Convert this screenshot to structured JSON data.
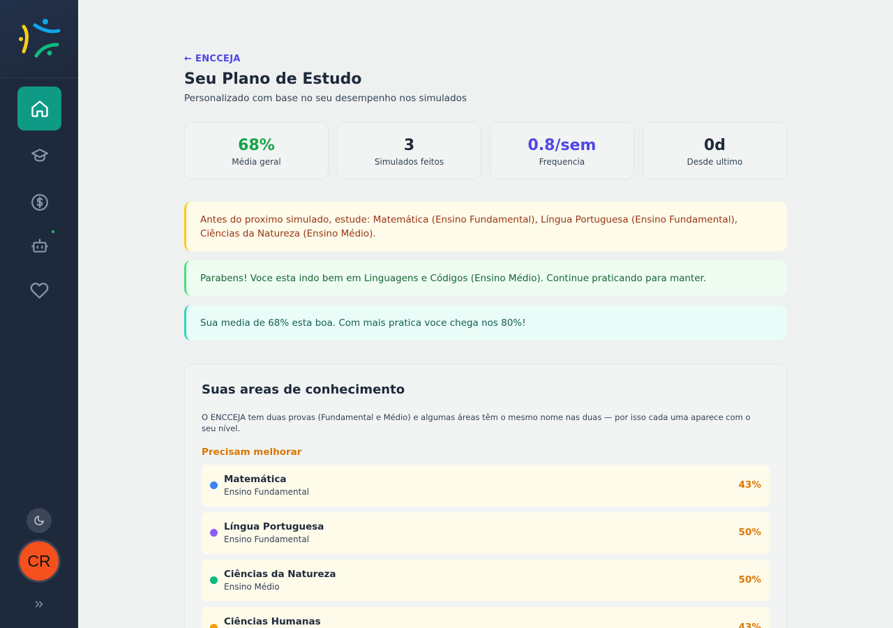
{
  "sidebar": {
    "nav": [
      {
        "name": "home",
        "icon": "home-icon",
        "active": true
      },
      {
        "name": "courses",
        "icon": "graduation-cap-icon",
        "active": false
      },
      {
        "name": "finance",
        "icon": "dollar-circle-icon",
        "active": false
      },
      {
        "name": "assistant",
        "icon": "bot-icon",
        "active": false
      },
      {
        "name": "favorites",
        "icon": "heart-icon",
        "active": false
      }
    ],
    "avatar_initials": "CR",
    "colors": {
      "background": "#1e293b",
      "active": "#0f9a86",
      "avatar": "#f4511e"
    }
  },
  "header": {
    "back_label": "← ENCCEJA",
    "title": "Seu Plano de Estudo",
    "subtitle": "Personalizado com base no seu desempenho nos simulados"
  },
  "stats": [
    {
      "value": "68%",
      "label": "Média geral",
      "color": "#16a34a"
    },
    {
      "value": "3",
      "label": "Simulados feitos",
      "color": "#1e293b"
    },
    {
      "value": "0.8/sem",
      "label": "Frequencia",
      "color": "#4f46e5"
    },
    {
      "value": "0d",
      "label": "Desde ultimo",
      "color": "#1e293b"
    }
  ],
  "alerts": {
    "warning": "Antes do proximo simulado, estude: Matemática (Ensino Fundamental), Língua Portuguesa (Ensino Fundamental), Ciências da Natureza (Ensino Médio).",
    "success": "Parabens! Voce esta indo bem em Linguagens e Códigos (Ensino Médio). Continue praticando para manter.",
    "info": "Sua media de 68% esta boa. Com mais pratica voce chega nos 80%!"
  },
  "areas": {
    "title": "Suas areas de conhecimento",
    "description": "O ENCCEJA tem duas provas (Fundamental e Médio) e algumas áreas têm o mesmo nome nas duas — por isso cada uma aparece com o seu nível.",
    "needs_improvement_label": "Precisam melhorar",
    "items": [
      {
        "name": "Matemática",
        "level": "Ensino Fundamental",
        "percent": "43%",
        "color": "#3b82f6"
      },
      {
        "name": "Língua Portuguesa",
        "level": "Ensino Fundamental",
        "percent": "50%",
        "color": "#8b5cf6"
      },
      {
        "name": "Ciências da Natureza",
        "level": "Ensino Médio",
        "percent": "50%",
        "color": "#10b981"
      },
      {
        "name": "Ciências Humanas",
        "level": "",
        "percent": "43%",
        "color": "#f59e0b"
      }
    ]
  }
}
